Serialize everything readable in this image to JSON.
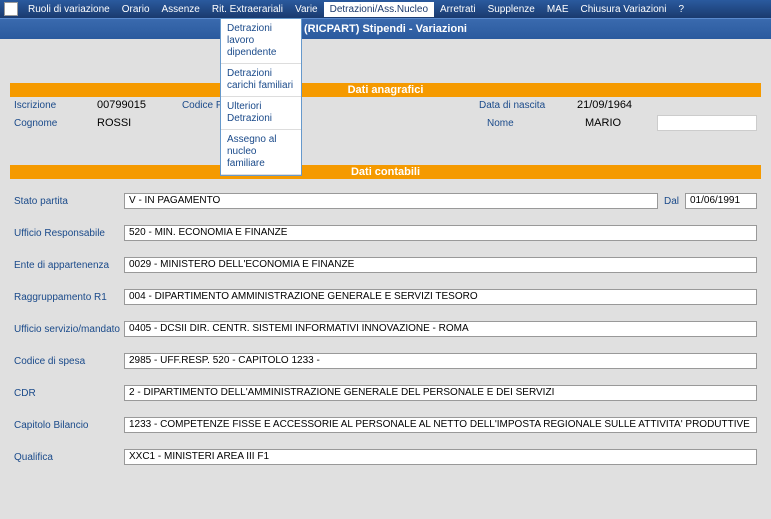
{
  "menu": {
    "items": [
      "Ruoli di variazione",
      "Orario",
      "Assenze",
      "Rit. Extraerariali",
      "Varie",
      "Detrazioni/Ass.Nucleo",
      "Arretrati",
      "Supplenze",
      "MAE",
      "Chiusura Variazioni",
      "?"
    ],
    "activeIndex": 5,
    "dropdown": [
      "Detrazioni lavoro dipendente",
      "Detrazioni carichi familiari",
      "Ulteriori Detrazioni",
      "Assegno al nucleo familiare"
    ]
  },
  "title": "(RICPART) Stipendi - Variazioni",
  "anagrafici": {
    "header": "Dati anagrafici",
    "iscrizione_label": "Iscrizione",
    "iscrizione_value": "00799015",
    "codice_fiscale_label": "Codice Fiscale",
    "codice_fiscale_value": "",
    "data_nascita_label": "Data di nascita",
    "data_nascita_value": "21/09/1964",
    "cognome_label": "Cognome",
    "cognome_value": "ROSSI",
    "nome_label": "Nome",
    "nome_value": "MARIO"
  },
  "contabili": {
    "header": "Dati contabili",
    "stato_partita_label": "Stato partita",
    "stato_partita_value": "V - IN PAGAMENTO",
    "dal_label": "Dal",
    "dal_value": "01/06/1991",
    "ufficio_responsabile_label": "Ufficio Responsabile",
    "ufficio_responsabile_value": "520 - MIN. ECONOMIA E FINANZE",
    "ente_label": "Ente di appartenenza",
    "ente_value": "0029 - MINISTERO DELL'ECONOMIA E FINANZE",
    "raggruppamento_label": "Raggruppamento R1",
    "raggruppamento_value": "004 - DIPARTIMENTO AMMINISTRAZIONE GENERALE E SERVIZI TESORO",
    "ufficio_servizio_label": "Ufficio servizio/mandato",
    "ufficio_servizio_value": "0405 - DCSII  DIR. CENTR. SISTEMI INFORMATIVI INNOVAZIONE - ROMA",
    "codice_spesa_label": "Codice di spesa",
    "codice_spesa_value": "2985 - UFF.RESP. 520 - CAPITOLO 1233 -",
    "cdr_label": "CDR",
    "cdr_value": "2 - DIPARTIMENTO DELL'AMMINISTRAZIONE GENERALE DEL PERSONALE E DEI SERVIZI",
    "capitolo_label": "Capitolo Bilancio",
    "capitolo_value": "1233 - COMPETENZE FISSE E ACCESSORIE AL PERSONALE AL NETTO DELL'IMPOSTA REGIONALE SULLE ATTIVITA' PRODUTTIVE",
    "qualifica_label": "Qualifica",
    "qualifica_value": "XXC1 - MINISTERI AREA III F1"
  }
}
